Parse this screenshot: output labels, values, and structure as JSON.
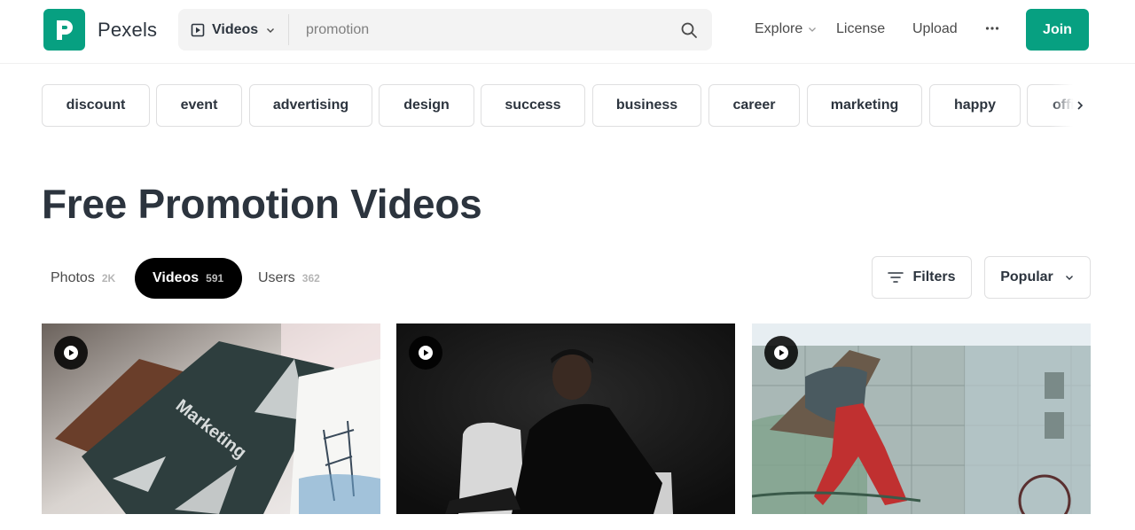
{
  "header": {
    "brand": "Pexels",
    "search_type": "Videos",
    "search_value": "promotion",
    "nav": {
      "explore": "Explore",
      "license": "License",
      "upload": "Upload",
      "join": "Join"
    },
    "accent": "#07a081"
  },
  "tags": [
    "discount",
    "event",
    "advertising",
    "design",
    "success",
    "business",
    "career",
    "marketing",
    "happy",
    "office"
  ],
  "page_title": "Free Promotion Videos",
  "tabs": [
    {
      "label": "Photos",
      "count": "2K",
      "active": false
    },
    {
      "label": "Videos",
      "count": "591",
      "active": true
    },
    {
      "label": "Users",
      "count": "362",
      "active": false
    }
  ],
  "controls": {
    "filters": "Filters",
    "sort": "Popular"
  },
  "videos": [
    {
      "book_text": "Marketing"
    },
    {},
    {}
  ]
}
